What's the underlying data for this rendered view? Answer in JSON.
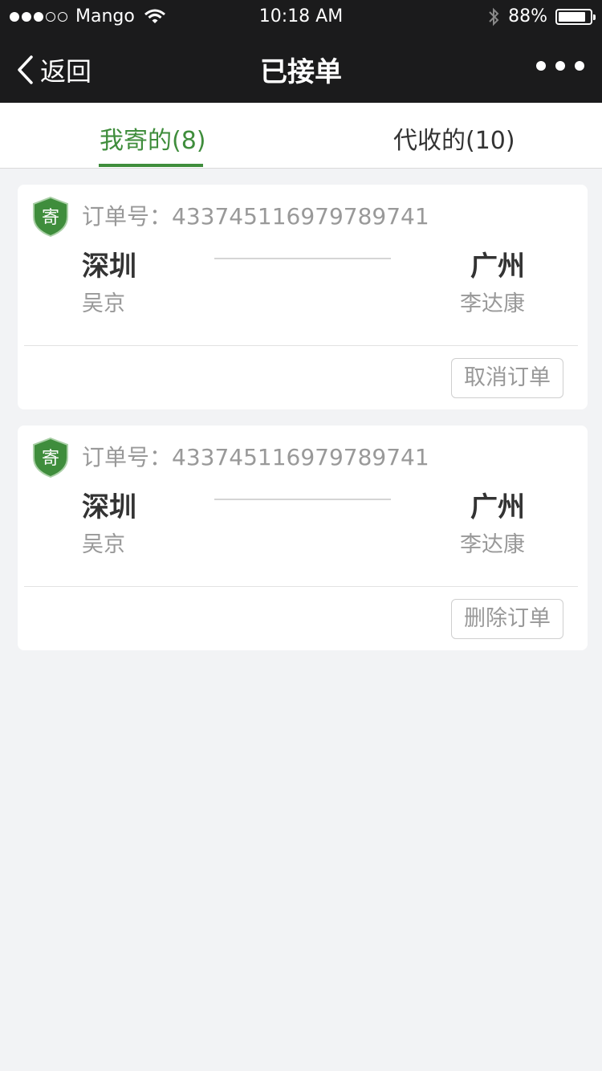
{
  "status_bar": {
    "carrier": "Mango",
    "time": "10:18 AM",
    "battery_text": "88%",
    "battery_level": 0.88
  },
  "nav": {
    "back_label": "返回",
    "title": "已接单"
  },
  "tabs": [
    {
      "label": "我寄的(8)",
      "active": true
    },
    {
      "label": "代收的(10)",
      "active": false
    }
  ],
  "orders": [
    {
      "badge": "寄",
      "order_no": "订单号：433745116979789741",
      "from_city": "深圳",
      "from_name": "吴京",
      "to_city": "广州",
      "to_name": "李达康",
      "action": "取消订单"
    },
    {
      "badge": "寄",
      "order_no": "订单号：433745116979789741",
      "from_city": "深圳",
      "from_name": "吴京",
      "to_city": "广州",
      "to_name": "李达康",
      "action": "删除订单"
    }
  ],
  "colors": {
    "header_bg": "#1b1b1c",
    "accent": "#3f8d3c",
    "page_bg": "#f2f3f5"
  }
}
